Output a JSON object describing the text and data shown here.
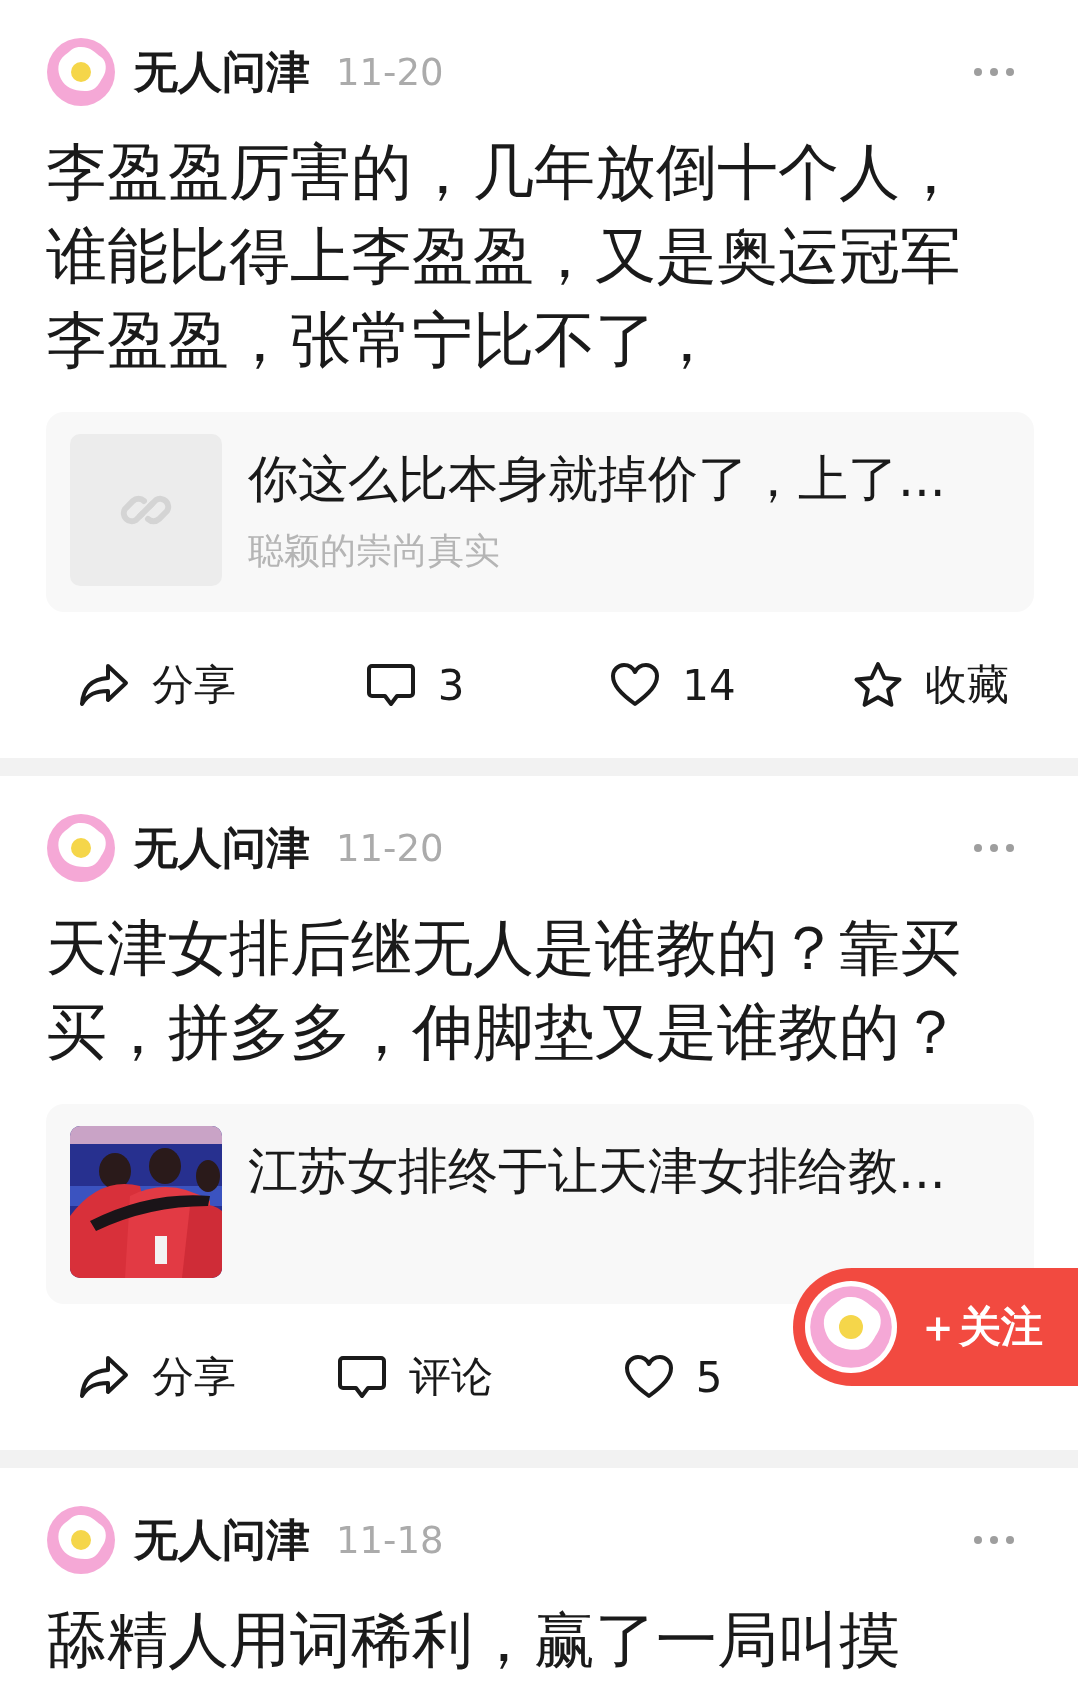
{
  "posts": [
    {
      "author": "无人问津",
      "date": "11-20",
      "body": "李盈盈厉害的，几年放倒十个人，谁能比得上李盈盈，又是奥运冠军李盈盈，张常宁比不了，",
      "link": {
        "kind": "link",
        "title": "你这么比本身就掉价了，上了...",
        "source": "聪颖的崇尚真实"
      },
      "actions": [
        {
          "kind": "share",
          "label": "分享"
        },
        {
          "kind": "comment",
          "label": "3"
        },
        {
          "kind": "like",
          "label": "14"
        },
        {
          "kind": "favorite",
          "label": "收藏"
        }
      ]
    },
    {
      "author": "无人问津",
      "date": "11-20",
      "body": "天津女排后继无人是谁教的？靠买买，拼多多，伸脚垫又是谁教的？",
      "link": {
        "kind": "picture",
        "title": "江苏女排终于让天津女排给教..."
      },
      "actions": [
        {
          "kind": "share",
          "label": "分享"
        },
        {
          "kind": "comment",
          "label": "评论"
        },
        {
          "kind": "like",
          "label": "5"
        }
      ]
    },
    {
      "author": "无人问津",
      "date": "11-18",
      "body": "舔精人用词稀利，赢了一局叫摸"
    }
  ],
  "follow_button": {
    "label": "＋关注"
  }
}
